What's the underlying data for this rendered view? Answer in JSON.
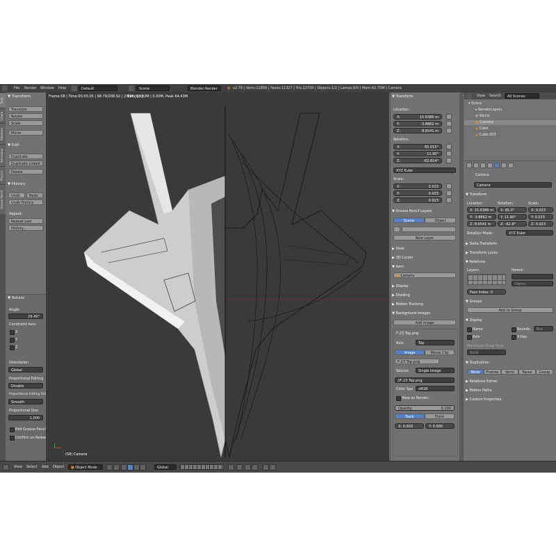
{
  "topbar": {
    "menus": [
      "File",
      "Render",
      "Window",
      "Help"
    ],
    "layout": "Default",
    "scene": "Scene",
    "engine": "Blender Render",
    "stats": "v2.79 | Verts:11856 | Faces:11327 | Tris:22706 | Objects:1/2 | Lamps:0/0 | Mem:42.75M | Camera"
  },
  "vtabs": [
    "Tools",
    "Create",
    "Relations",
    "Animation",
    "Physics",
    "Grease Pencil"
  ],
  "toolshelf": {
    "transform_header": "Transform",
    "transform_buttons": [
      "Translate",
      "Rotate",
      "Scale",
      "Mirror"
    ],
    "edit_header": "Edit",
    "edit_buttons": [
      "Duplicate",
      "Duplicate Linked",
      "Delete"
    ],
    "history_header": "History",
    "undo": "Undo",
    "redo": "Redo",
    "undo_history": "Undo History",
    "repeat_label": "Repeat:",
    "repeat_last": "Repeat Last",
    "history": "History...",
    "rotate_header": "Rotate",
    "angle_label": "Angle:",
    "angle_value": "29.49°",
    "constraint_label": "Constraint Axis:",
    "axes": [
      "X",
      "Y",
      "Z"
    ],
    "orientation_label": "Orientation",
    "orientation_value": "Global",
    "prop_edit_label": "Proportional Editing",
    "prop_edit_value": "Disable",
    "prop_falloff_label": "Proportional Editing Falloff",
    "prop_falloff_value": "Smooth",
    "prop_size_label": "Proportional Size",
    "prop_size_value": "1.000",
    "edit_grease": "Edit Grease Pencil",
    "confirm_release": "Confirm on Release"
  },
  "viewport": {
    "info": "Frame:58 | Time:00:03.05 | 98.79/208.92 | 2 135 | [ui]",
    "mem": "Mem:63.92M | 0.00M, Peak 64.43M",
    "object_label": "(58) Camera"
  },
  "npanel": {
    "transform_header": "Transform",
    "location_label": "Location:",
    "location": [
      {
        "k": "X:",
        "v": "15.6386 m"
      },
      {
        "k": "Y:",
        "v": "-3.8862 m"
      },
      {
        "k": "Z:",
        "v": "8.6541 m"
      }
    ],
    "rotation_label": "Rotation:",
    "rotation": [
      {
        "k": "X:",
        "v": "65.015°"
      },
      {
        "k": "Y:",
        "v": "11.90°"
      },
      {
        "k": "Z:",
        "v": "-62.814°"
      }
    ],
    "rotation_mode": "XYZ Euler",
    "scale_label": "Scale:",
    "scale": [
      {
        "k": "X:",
        "v": "0.023"
      },
      {
        "k": "Y:",
        "v": "0.023"
      },
      {
        "k": "Z:",
        "v": "0.023"
      }
    ],
    "grease_header": "Grease Pencil Layers",
    "scene_tab": "Scene",
    "object_tab": "Object",
    "new_layer": "New Layer",
    "view_header": "View",
    "cursor_header": "3D Cursor",
    "item_header": "Item",
    "item_name": "Camera",
    "display_header": "Display",
    "shading_header": "Shading",
    "motion_header": "Motion Tracking",
    "bg_header": "Background Images",
    "add_image": "Add Image",
    "image_name": "F-23 Top.png",
    "axis_label": "Axis:",
    "axis_value": "Top",
    "image_tab": "Image",
    "movie_tab": "Movie Clip",
    "image_field": "F-23 Top.png",
    "source_label": "Source:",
    "source_value": "Single Image",
    "file_path": "//F-23 Top.png",
    "colorspace_label": "Color Spa",
    "colorspace_value": "sRGB",
    "view_as_render": "View as Render",
    "opacity_label": "Opacity:",
    "opacity_value": "0.200",
    "back_btn": "Back",
    "front_btn": "Front",
    "x_offset": "X: 0.000",
    "y_offset": "Y: 0.000"
  },
  "outliner": {
    "view": "View",
    "search": "Search",
    "scenes": "All Scenes",
    "rows": [
      "Scene",
      "RenderLayers",
      "World",
      "Camera",
      "Cube",
      "Cube.003"
    ]
  },
  "properties": {
    "object_name": "Camera",
    "name_field": "Camera",
    "transform_header": "Transform",
    "loc_label": "Location:",
    "rot_label": "Rotation:",
    "scale_label": "Scale:",
    "loc": [
      "X: 15.6386 m",
      "Y: -3.8862 m",
      "Z: 8.6541 m"
    ],
    "rot": [
      "X: 65.0°",
      "Y: 11.90°",
      "Z: -62.8°"
    ],
    "scl": [
      "X: 0.023",
      "Y: 0.023",
      "Z: 0.023"
    ],
    "rot_mode_label": "Rotation Mode:",
    "rot_mode_value": "XYZ Euler",
    "delta_header": "Delta Transform",
    "locks_header": "Transform Locks",
    "relations_header": "Relations",
    "layers_label": "Layers:",
    "parent_label": "Parent:",
    "parent_type": "Object",
    "pass_index": "Pass Index: 0",
    "groups_header": "Groups",
    "add_group": "Add to Group",
    "display_header": "Display",
    "disp_opts": [
      "Name",
      "Bounds",
      "Axis",
      "X-Ray"
    ],
    "bounds_type": "Box",
    "max_draw_label": "Maximum Draw Type:",
    "max_draw_value": "Solid",
    "dup_header": "Duplication",
    "dup_tabs": [
      "None",
      "Frames",
      "Verts",
      "Faces",
      "Group"
    ],
    "extras_header": "Relations Extras",
    "motion_header": "Motion Paths",
    "custom_header": "Custom Properties"
  },
  "bottombar": {
    "menus": [
      "View",
      "Select",
      "Add",
      "Object"
    ],
    "mode": "Object Mode",
    "orientation": "Global"
  }
}
